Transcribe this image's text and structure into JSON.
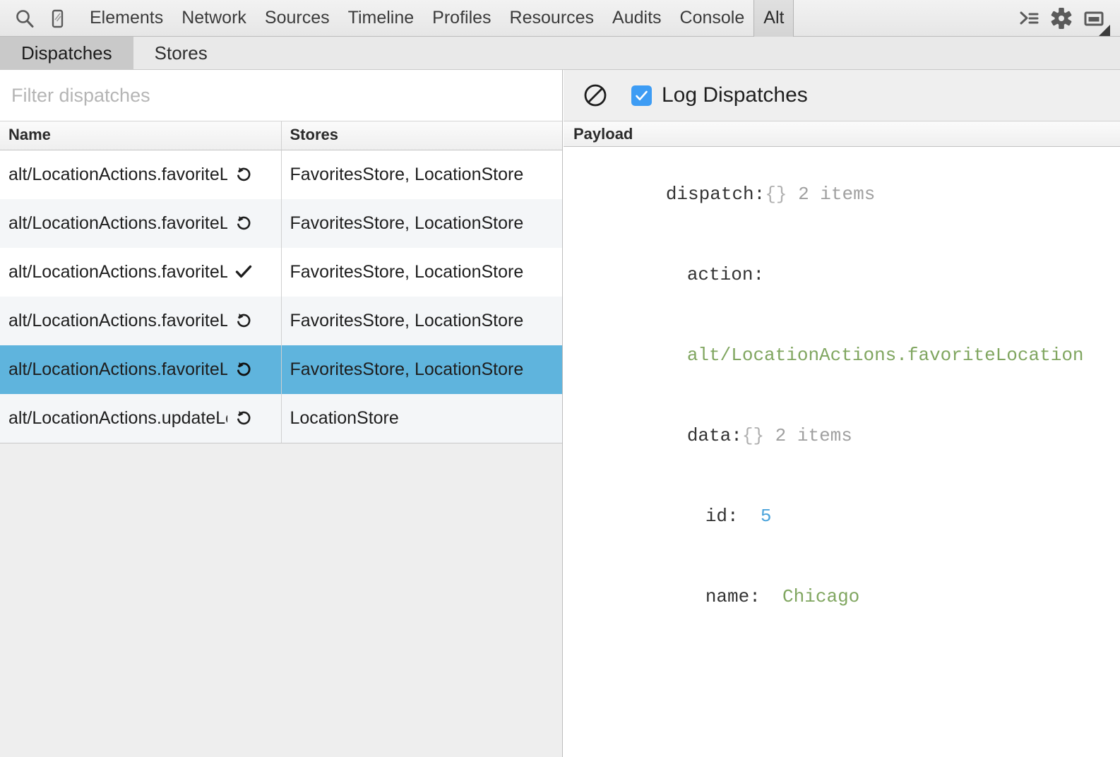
{
  "devtools_toolbar": {
    "icons": {
      "inspect": "search-icon",
      "device": "mobile-device-icon",
      "console_drawer": "console-prompt-icon",
      "settings": "gear-icon",
      "dock": "dock-panel-icon"
    },
    "tabs": [
      {
        "label": "Elements",
        "selected": false
      },
      {
        "label": "Network",
        "selected": false
      },
      {
        "label": "Sources",
        "selected": false
      },
      {
        "label": "Timeline",
        "selected": false
      },
      {
        "label": "Profiles",
        "selected": false
      },
      {
        "label": "Resources",
        "selected": false
      },
      {
        "label": "Audits",
        "selected": false
      },
      {
        "label": "Console",
        "selected": false
      },
      {
        "label": "Alt",
        "selected": true
      }
    ]
  },
  "panel_tabs": [
    {
      "label": "Dispatches",
      "active": true
    },
    {
      "label": "Stores",
      "active": false
    }
  ],
  "left_pane": {
    "filter": {
      "value": "",
      "placeholder": "Filter dispatches"
    },
    "columns": [
      "Name",
      "Stores"
    ],
    "rows": [
      {
        "name": "alt/LocationActions.favoriteLoca",
        "stores": "FavoritesStore, LocationStore",
        "icon": "replay-icon",
        "selected": false
      },
      {
        "name": "alt/LocationActions.favoriteLoca",
        "stores": "FavoritesStore, LocationStore",
        "icon": "replay-icon",
        "selected": false
      },
      {
        "name": "alt/LocationActions.favoriteLoca",
        "stores": "FavoritesStore, LocationStore",
        "icon": "checkmark-icon",
        "selected": false
      },
      {
        "name": "alt/LocationActions.favoriteLoca",
        "stores": "FavoritesStore, LocationStore",
        "icon": "replay-icon",
        "selected": false
      },
      {
        "name": "alt/LocationActions.favoriteLoca",
        "stores": "FavoritesStore, LocationStore",
        "icon": "replay-icon",
        "selected": true
      },
      {
        "name": "alt/LocationActions.updateLoca",
        "stores": "LocationStore",
        "icon": "replay-icon",
        "selected": false
      }
    ]
  },
  "right_pane": {
    "toolbar": {
      "clear_icon": "clear-no-entry-icon",
      "log_dispatches_label": "Log Dispatches",
      "log_dispatches_checked": true
    },
    "payload_header": "Payload",
    "payload_lines": [
      {
        "indent": 0,
        "parts": [
          {
            "text": "dispatch:",
            "cls": "pl-key"
          },
          {
            "text": "{}",
            "cls": "pl-brace"
          },
          {
            "text": " 2 items",
            "cls": "pl-count"
          }
        ]
      },
      {
        "indent": 1,
        "parts": [
          {
            "text": "action:",
            "cls": "pl-key"
          }
        ]
      },
      {
        "indent": 1,
        "parts": [
          {
            "text": "alt/LocationActions.favoriteLocation",
            "cls": "pl-string"
          }
        ]
      },
      {
        "indent": 1,
        "parts": [
          {
            "text": "data:",
            "cls": "pl-key"
          },
          {
            "text": "{}",
            "cls": "pl-brace"
          },
          {
            "text": " 2 items",
            "cls": "pl-count"
          }
        ]
      },
      {
        "indent": 2,
        "parts": [
          {
            "text": "id: ",
            "cls": "pl-key"
          },
          {
            "text": " 5",
            "cls": "pl-number"
          }
        ]
      },
      {
        "indent": 2,
        "parts": [
          {
            "text": "name: ",
            "cls": "pl-key"
          },
          {
            "text": " Chicago",
            "cls": "pl-string"
          }
        ]
      }
    ]
  },
  "colors": {
    "selection_blue": "#5fb4dd",
    "checkbox_blue": "#3d9cf4",
    "string_green": "#80a660",
    "number_blue": "#4aa3db",
    "row_alt": "#f4f6f8",
    "pane_bg": "#eeeeee"
  }
}
